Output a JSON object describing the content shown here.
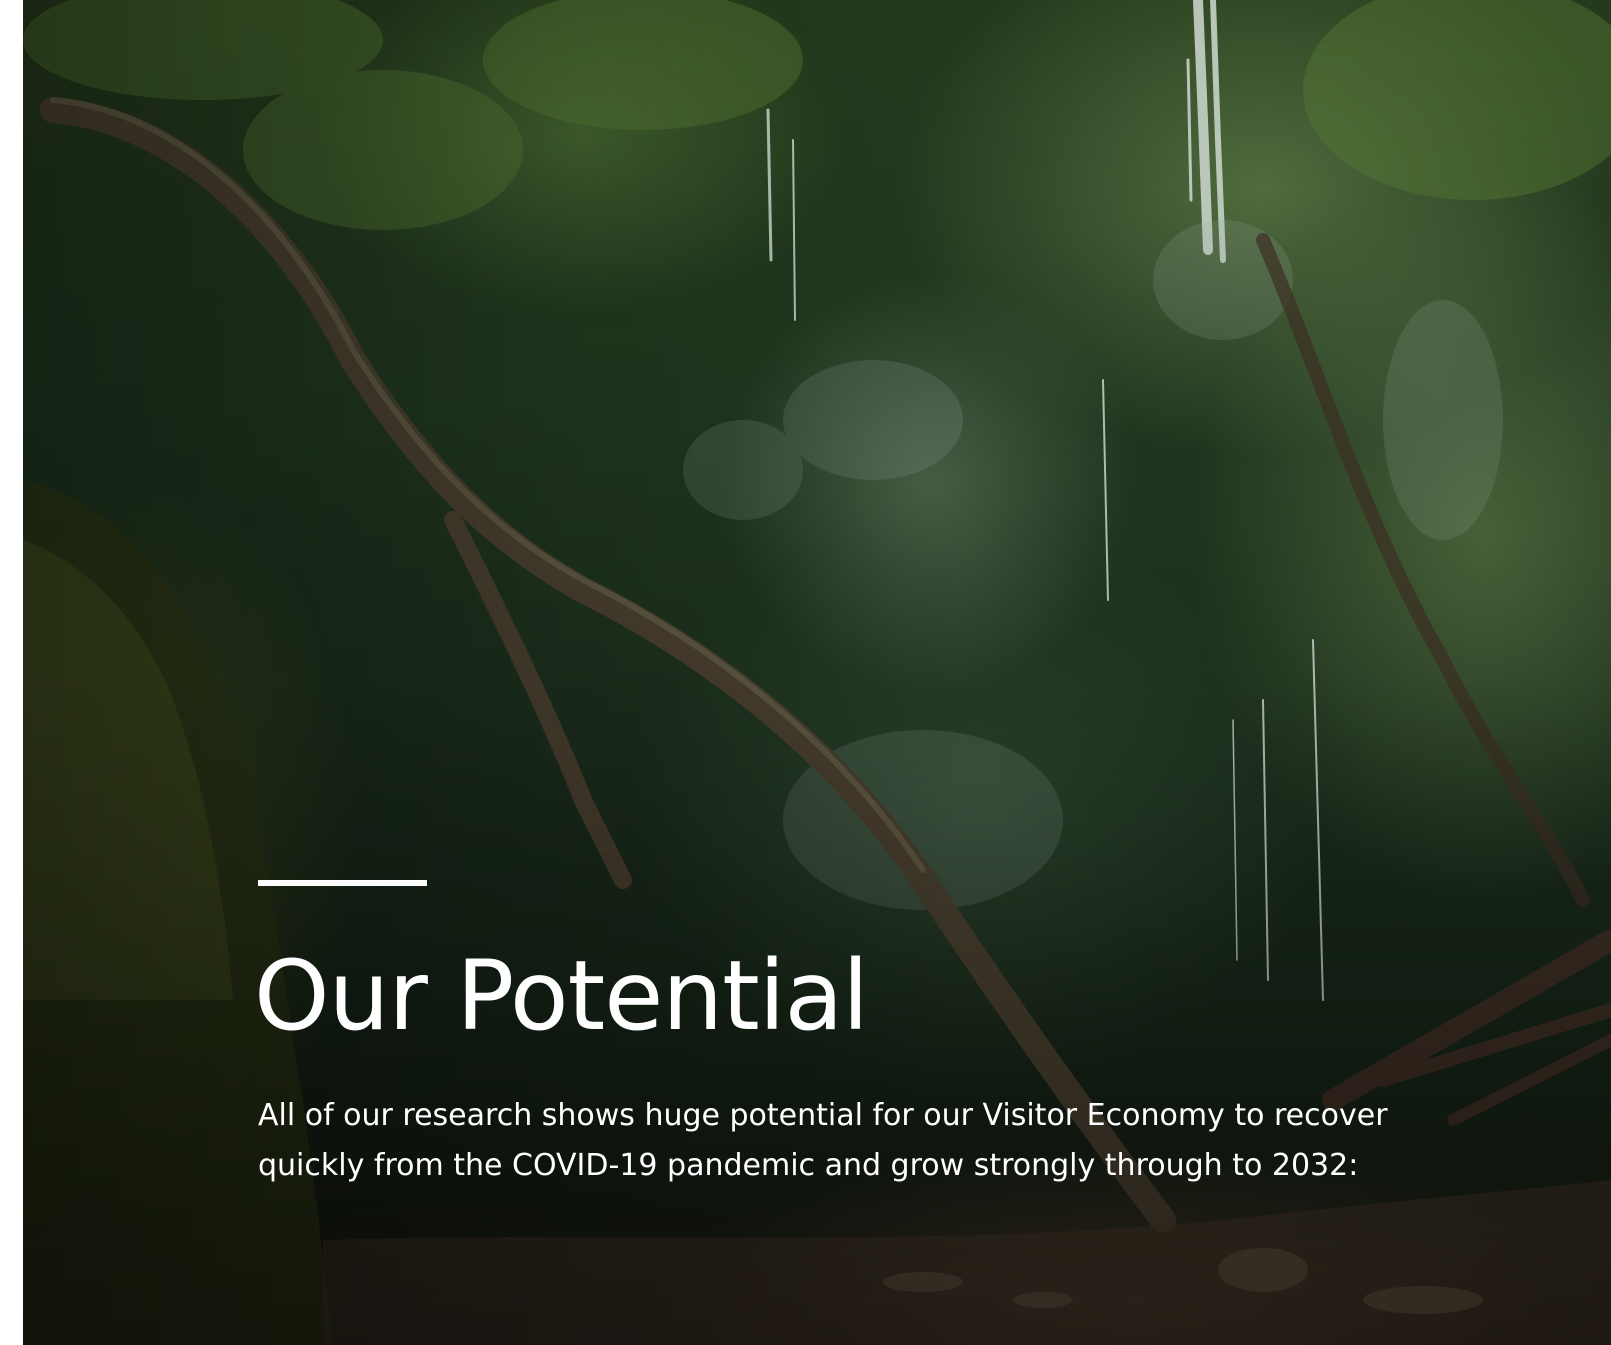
{
  "hero": {
    "title": "Our Potential",
    "body": "All of our research shows huge potential for our Visitor Economy to recover quickly from the COVID-19 pandemic and grow strongly through to 2032:"
  },
  "colors": {
    "text": "#ffffff",
    "page_background": "#ffffff",
    "moss_green": "#3e5a2a",
    "rock_dark": "#18241a"
  }
}
